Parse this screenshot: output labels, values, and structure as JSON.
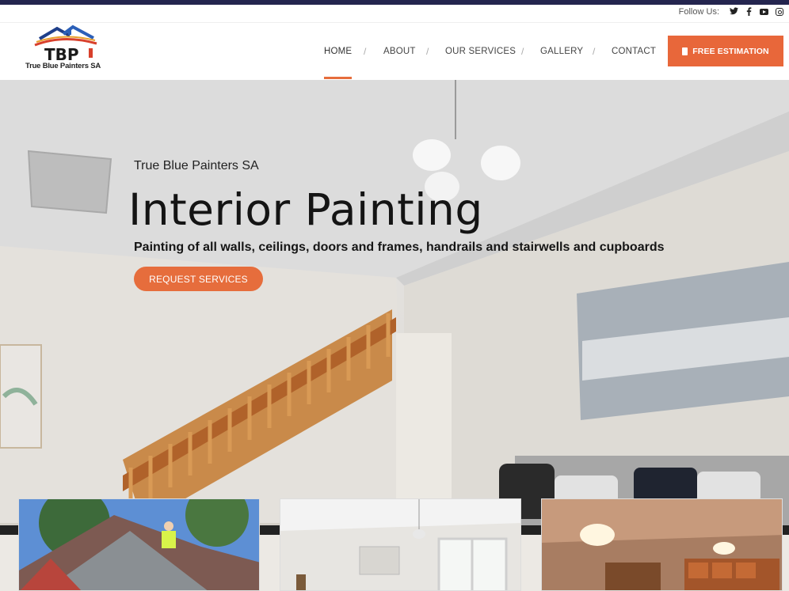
{
  "topbar": {
    "follow_label": "Follow Us:",
    "social_icons": [
      "twitter-icon",
      "facebook-icon",
      "youtube-icon",
      "instagram-icon"
    ]
  },
  "brand": {
    "logo_initials": "TBP",
    "logo_name": "True Blue Painters SA"
  },
  "nav": {
    "items": [
      {
        "label": "HOME",
        "active": true
      },
      {
        "label": "ABOUT",
        "active": false
      },
      {
        "label": "OUR SERVICES",
        "active": false
      },
      {
        "label": "GALLERY",
        "active": false
      },
      {
        "label": "CONTACT",
        "active": false
      }
    ],
    "separator": "/",
    "cta_label": "FREE ESTIMATION"
  },
  "hero": {
    "subtitle": "True Blue Painters SA",
    "title": "Interior Painting",
    "description": "Painting of all walls, ceilings, doors and frames, handrails and stairwells and cupboards",
    "button_label": "REQUEST SERVICES"
  },
  "colors": {
    "accent": "#e8673a",
    "navy": "#24254f",
    "text_dark": "#141414"
  }
}
